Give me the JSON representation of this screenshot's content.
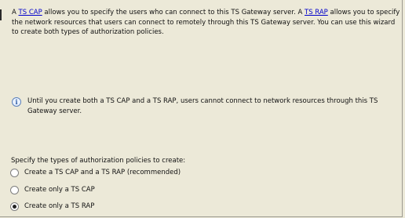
{
  "intro": {
    "t1": "A ",
    "link_cap": "TS CAP",
    "t2": " allows you to specify the users who can connect to this TS Gateway server. A ",
    "link_rap": "TS RAP",
    "t3": " allows you to specify the network resources that users can connect to remotely through this TS Gateway server. You can use this wizard to create both types of authorization policies."
  },
  "note": {
    "icon": "info-icon",
    "text": "Until you create both a TS CAP and a TS RAP, users cannot connect to network resources through this TS Gateway server."
  },
  "policy_prompt": "Specify the types of authorization policies to create:",
  "options": [
    {
      "label": "Create a TS CAP and a TS RAP (recommended)",
      "selected": false
    },
    {
      "label": "Create only a TS CAP",
      "selected": false
    },
    {
      "label": "Create only a TS RAP",
      "selected": true
    }
  ],
  "colors": {
    "background": "#ece9d8",
    "link": "#0000cc"
  }
}
